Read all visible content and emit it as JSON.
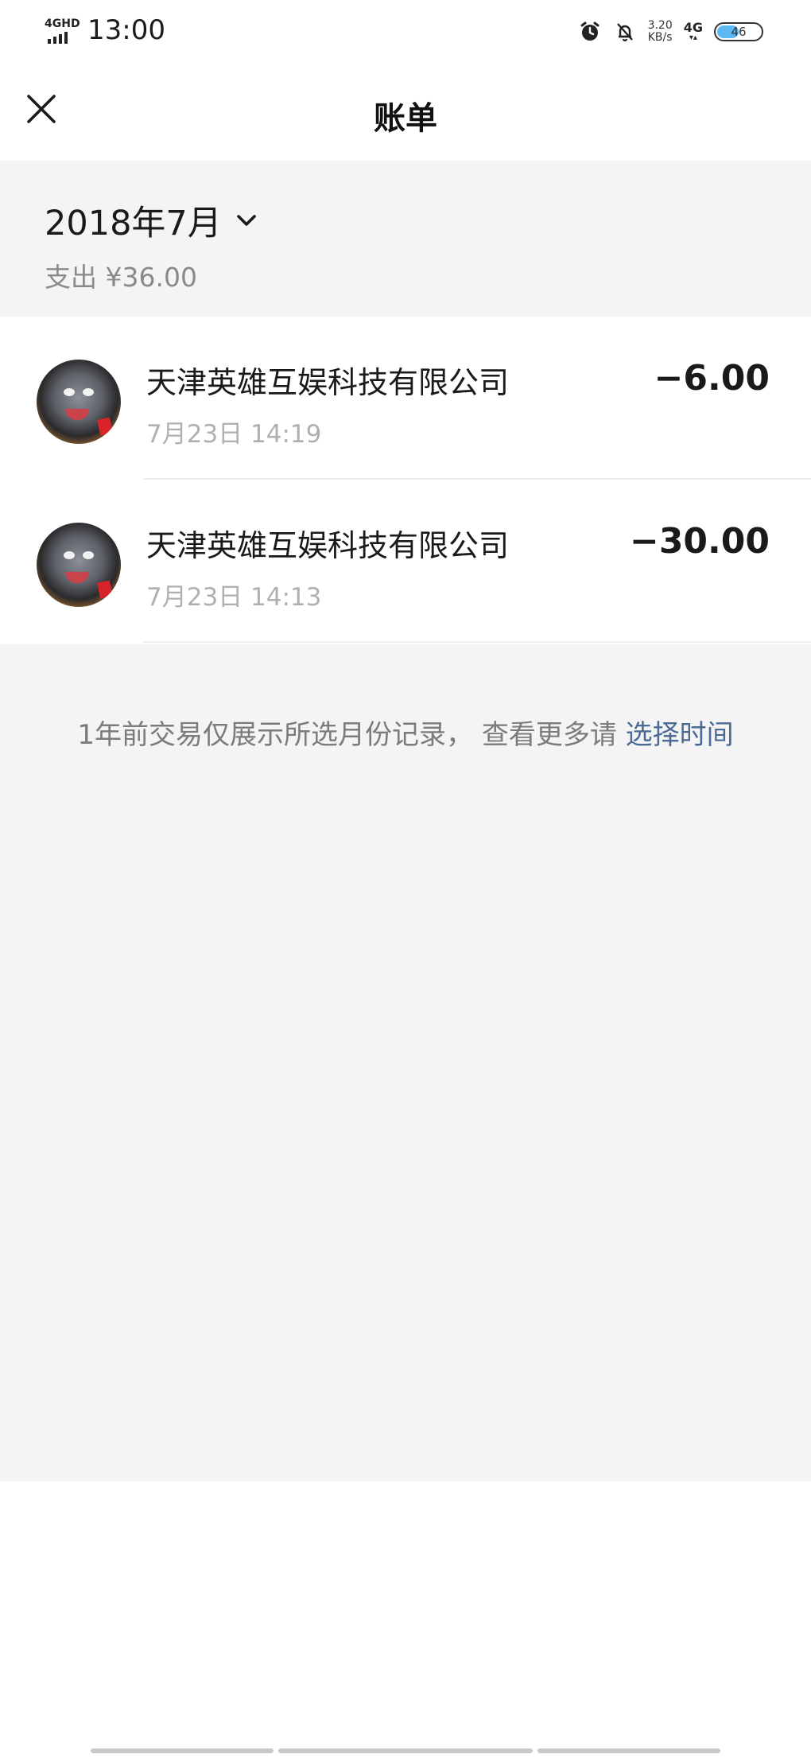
{
  "status_bar": {
    "network_label": "4GHD",
    "time": "13:00",
    "speed_value": "3.20",
    "speed_unit": "KB/s",
    "net_type": "4G",
    "battery_level": "46"
  },
  "nav": {
    "title": "账单"
  },
  "summary": {
    "month": "2018年7月",
    "spend": "支出 ¥36.00"
  },
  "transactions": [
    {
      "merchant": "天津英雄互娱科技有限公司",
      "datetime": "7月23日 14:19",
      "amount": "−6.00"
    },
    {
      "merchant": "天津英雄互娱科技有限公司",
      "datetime": "7月23日 14:13",
      "amount": "−30.00"
    }
  ],
  "notice": {
    "text": "1年前交易仅展示所选月份记录， 查看更多请 ",
    "link": "选择时间"
  },
  "colors": {
    "background": "#f4f4f4",
    "link": "#4a6a95",
    "battery_fill": "#5bb8f0"
  }
}
